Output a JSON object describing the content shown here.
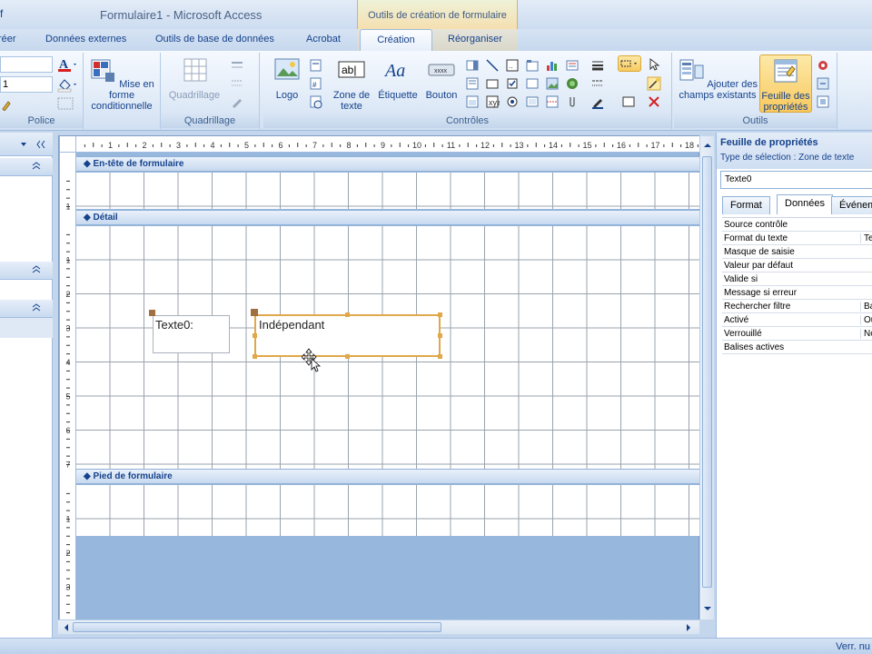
{
  "titlebar": {
    "qa_icon": "f",
    "app_title": "Formulaire1 - Microsoft Access",
    "context_title": "Outils de création de formulaire"
  },
  "tabs": {
    "creer": "réer",
    "donnees_externes": "Données externes",
    "outils_bd": "Outils de base de données",
    "acrobat": "Acrobat",
    "creation": "Création",
    "reorganiser": "Réorganiser"
  },
  "ribbon": {
    "police": {
      "label": "Police",
      "size_value": "1",
      "font_value": "1"
    },
    "mise_en_forme": "Mise en forme conditionnelle",
    "quadrillage": {
      "button": "Quadrillage",
      "label": "Quadrillage"
    },
    "controles": {
      "logo": "Logo",
      "zone_texte": "Zone de texte",
      "etiquette": "Étiquette",
      "bouton": "Bouton",
      "label": "Contrôles"
    },
    "outils": {
      "ajouter_champs": "Ajouter des champs existants",
      "feuille_proprietes": "Feuille des propriétés",
      "label": "Outils"
    }
  },
  "designer": {
    "header_band": "En-tête de formulaire",
    "detail_band": "Détail",
    "footer_band": "Pied de formulaire",
    "ruler_top_ticks": [
      "1",
      "2",
      "3",
      "4",
      "5",
      "6",
      "7",
      "8",
      "9",
      "10",
      "11",
      "12",
      "13",
      "14",
      "15",
      "16",
      "17",
      "18"
    ],
    "ruler_left_header": [
      "1"
    ],
    "ruler_left_detail": [
      "1",
      "2",
      "3",
      "4",
      "5",
      "6",
      "7"
    ],
    "ruler_left_footer": [
      "1",
      "2",
      "3"
    ],
    "label_text": "Texte0:",
    "textbox_text": "Indépendant"
  },
  "property_sheet": {
    "title": "Feuille de propriétés",
    "selection_type": "Type de sélection :  Zone de texte",
    "selected_object": "Texte0",
    "tabs": [
      "Format",
      "Données",
      "Événem"
    ],
    "active_tab": "Données",
    "rows": [
      {
        "name": "Source contrôle",
        "value": ""
      },
      {
        "name": "Format du texte",
        "value": "Te"
      },
      {
        "name": "Masque de saisie",
        "value": ""
      },
      {
        "name": "Valeur par défaut",
        "value": ""
      },
      {
        "name": "Valide si",
        "value": ""
      },
      {
        "name": "Message si erreur",
        "value": ""
      },
      {
        "name": "Rechercher filtre",
        "value": "Ba"
      },
      {
        "name": "Activé",
        "value": "Ou"
      },
      {
        "name": "Verrouillé",
        "value": "No"
      },
      {
        "name": "Balises actives",
        "value": ""
      }
    ]
  },
  "status": {
    "text": "Verr. nu"
  }
}
